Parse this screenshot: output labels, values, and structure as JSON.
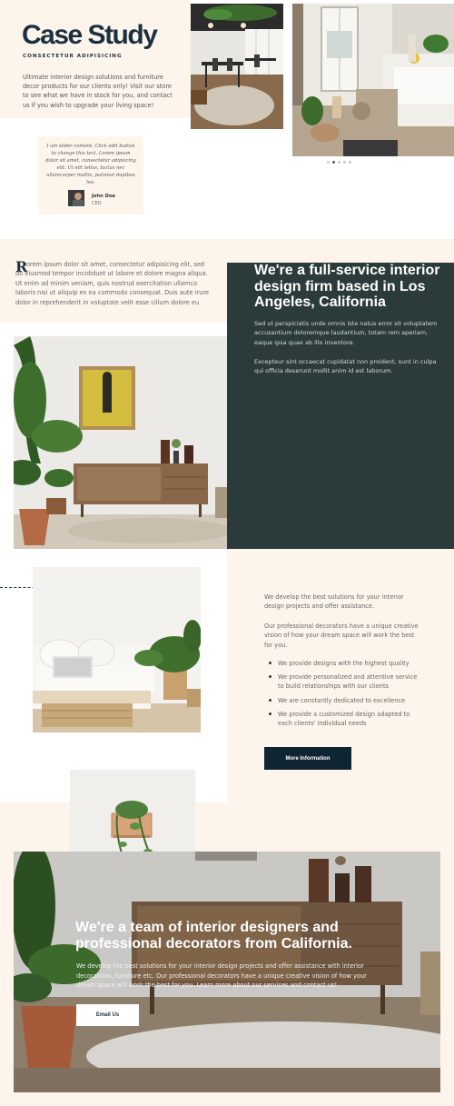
{
  "hero": {
    "title": "Case Study",
    "subtitle": "CONSECTETUR ADIPISICING",
    "text": "Ultimate interior design solutions and furniture decor products for our clients only! Visit our store to see what we have in stock for you, and contact us if you wish to upgrade your living space!"
  },
  "gallery": {
    "slide_count": 5,
    "active_slide": 2
  },
  "testimonial": {
    "quote": "I am slider content. Click edit button to change this text. Lorem ipsum dolor sit amet, consectetur adipiscing elit. Ut elit tellus, luctus nec ullamcorper mattis, pulvinar dapibus leo.",
    "name": "John Doe",
    "role": "CEO"
  },
  "intro": {
    "drop_cap": "R",
    "paragraph": "orem ipsum dolor sit amet, consectetur adipisicing elit, sed do eiusmod tempor incididunt ut labore et dolore magna aliqua. Ut enim ad minim veniam, quis nostrud exercitation ullamco laboris nisi ut aliquip ex ea commodo consequat. Duis aute irure dolor in reprehenderit in voluptate velit esse cillum dolore eu"
  },
  "full_service": {
    "heading": "We're a full-service interior design firm based in Los Angeles, California",
    "p1": "Sed ut perspiciatis unde omnis iste natus error sit voluptatem accusantium doloremque laudantium, totam rem aperiam, eaque ipsa quae ab illo inventore.",
    "p2": "Excepteur sint occaecat cupidatat non proident, sunt in culpa qui officia deserunt mollit anim id est laborum."
  },
  "solutions": {
    "p1": "We develop the best solutions for your interior design projects and offer assistance.",
    "p2": "Our professional decorators have a unique creative vision of how your dream space will work the best for you.",
    "list": [
      "We provide designs with the highest quality",
      "We provide personalized and attentive service to build relationships with our clients",
      "We are constantly dedicated to excellence",
      "We provide a customized design adapted to each clients' individual needs"
    ],
    "button": "More Information"
  },
  "team": {
    "heading": "We're a team of interior designers and professional decorators from California.",
    "text": "We develop the best solutions for your interior design projects and offer assistance with interior decorations, furniture etc. Our professional decorators have a unique creative vision of how your dream space will work the best for you. Learn more about our services and contact us!",
    "button": "Email Us"
  },
  "colors": {
    "cream": "#fdf5ec",
    "navy": "#1c3140",
    "dark_panel": "#2b3a3b",
    "button_dark": "#0f2534"
  }
}
